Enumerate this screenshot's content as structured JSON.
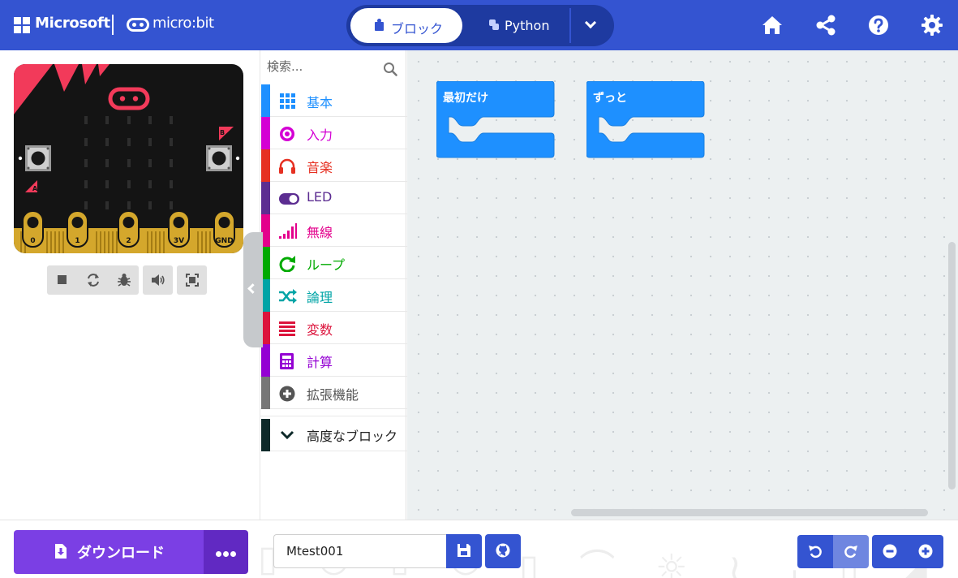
{
  "header": {
    "brand_ms": "Microsoft",
    "brand_mb": "micro:bit",
    "mode_blocks": "ブロック",
    "mode_python": "Python",
    "accent": "#3454d1"
  },
  "simulator": {
    "pins": [
      "0",
      "1",
      "2",
      "3V",
      "GND"
    ],
    "btn_a": "A",
    "btn_b": "B"
  },
  "toolbox": {
    "search_placeholder": "検索...",
    "categories": [
      {
        "label": "基本",
        "color": "#1e90ff",
        "icon": "grid-icon"
      },
      {
        "label": "入力",
        "color": "#d400d4",
        "icon": "target-icon"
      },
      {
        "label": "音楽",
        "color": "#e63022",
        "icon": "headphones-icon"
      },
      {
        "label": "LED",
        "color": "#5c2d91",
        "icon": "toggle-icon"
      },
      {
        "label": "無線",
        "color": "#e3008c",
        "icon": "signal-icon"
      },
      {
        "label": "ループ",
        "color": "#00aa00",
        "icon": "refresh-icon"
      },
      {
        "label": "論理",
        "color": "#00a4a6",
        "icon": "shuffle-icon"
      },
      {
        "label": "変数",
        "color": "#dc143c",
        "icon": "list-icon"
      },
      {
        "label": "計算",
        "color": "#9400d3",
        "icon": "calculator-icon"
      },
      {
        "label": "拡張機能",
        "color": "#777777",
        "icon": "plus-circle-icon"
      },
      {
        "label": "高度なブロック",
        "color": "#0e2a2a",
        "icon": "chevron-down-icon"
      }
    ]
  },
  "workspace": {
    "blocks": [
      {
        "label": "最初だけ",
        "color": "#1e90ff"
      },
      {
        "label": "ずっと",
        "color": "#1e90ff"
      }
    ]
  },
  "footer": {
    "download_label": "ダウンロード",
    "project_name": "Mtest001"
  }
}
